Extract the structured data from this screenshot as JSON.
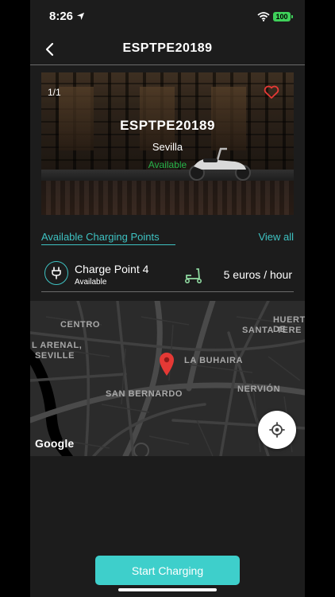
{
  "status_bar": {
    "time": "8:26",
    "battery": "100"
  },
  "nav": {
    "title": "ESPTPE20189"
  },
  "hero": {
    "counter": "1/1",
    "title": "ESPTPE20189",
    "city": "Sevilla",
    "status": "Available"
  },
  "section": {
    "title": "Available Charging Points",
    "view_all": "View all"
  },
  "charge_point": {
    "name": "Charge Point 4",
    "status": "Available",
    "price": "5 euros / hour"
  },
  "map": {
    "labels": [
      "CENTRO",
      "HUERTA DE",
      "SANTA TERE",
      "L ARENAL,",
      "SEVILLE",
      "LA BUHAIRA",
      "SAN BERNARDO",
      "NERVIÓN"
    ],
    "attribution": "Google"
  },
  "actions": {
    "start_charging": "Start Charging"
  },
  "colors": {
    "accent": "#3ec2c2",
    "available": "#27b34a",
    "pin": "#e53935",
    "button": "#3ecfcb"
  }
}
